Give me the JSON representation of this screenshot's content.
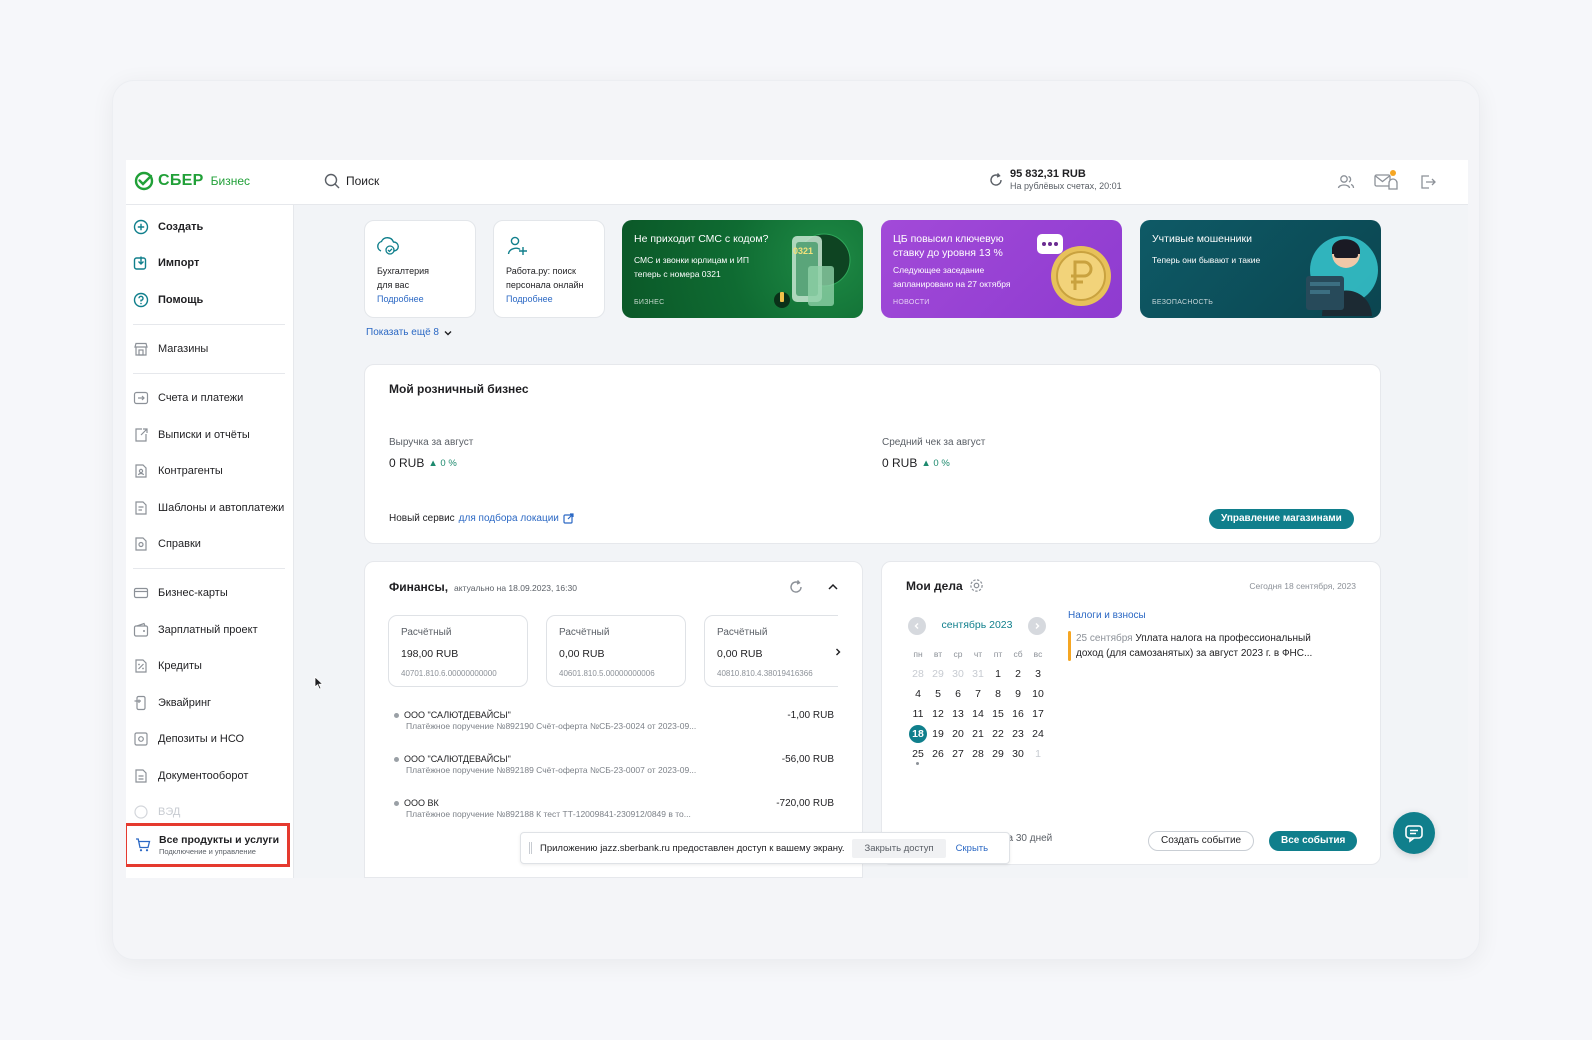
{
  "header": {
    "logo_text": "СБЕР",
    "logo_sub": "Бизнес",
    "search_label": "Поиск",
    "balance_amount": "95 832,31 RUB",
    "balance_sub": "На рублёвых счетах, 20:01"
  },
  "sidebar": {
    "create": "Создать",
    "import": "Импорт",
    "help": "Помощь",
    "shops": "Магазины",
    "accounts": "Счета и платежи",
    "statements": "Выписки и отчёты",
    "counterparties": "Контрагенты",
    "templates": "Шаблоны и автоплатежи",
    "certificates": "Справки",
    "cards": "Бизнес-карты",
    "salary": "Зарплатный проект",
    "credits": "Кредиты",
    "acquiring": "Эквайринг",
    "deposits": "Депозиты и НСО",
    "docs": "Документооборот",
    "ved": "ВЭД",
    "all_products": "Все продукты и услуги",
    "all_products_sub": "Подключение и управление"
  },
  "promos": {
    "p1_line1": "Бухгалтерия",
    "p1_line2": "для вас",
    "p1_link": "Подробнее",
    "p2_line1": "Работа.ру: поиск",
    "p2_line2": "персонала онлайн",
    "p2_link": "Подробнее",
    "p3_title": "Не приходит СМС с кодом?",
    "p3_body1": "СМС и звонки юрлицам и ИП",
    "p3_body2": "теперь с номера 0321",
    "p3_tag": "БИЗНЕС",
    "p3_badge": "0321",
    "p4_title1": "ЦБ повысил ключевую",
    "p4_title2": "ставку до уровня 13 %",
    "p4_body1": "Следующее заседание",
    "p4_body2": "запланировано на 27 октября",
    "p4_tag": "НОВОСТИ",
    "p5_title": "Учтивые мошенники",
    "p5_body": "Теперь они бывают и такие",
    "p5_tag": "БЕЗОПАСНОСТЬ",
    "show_more": "Показать ещё 8"
  },
  "retail": {
    "title": "Мой розничный бизнес",
    "revenue_label": "Выручка за август",
    "revenue_value": "0 RUB",
    "revenue_delta": "0 %",
    "avg_label": "Средний чек за август",
    "avg_value": "0 RUB",
    "avg_delta": "0 %",
    "service_text": "Новый сервис",
    "service_link": "для подбора локации",
    "manage_button": "Управление магазинами"
  },
  "finance": {
    "title": "Финансы,",
    "updated": "актуально на 18.09.2023, 16:30",
    "accounts": [
      {
        "type": "Расчётный",
        "amount": "198,00 RUB",
        "number": "40701.810.6.00000000000"
      },
      {
        "type": "Расчётный",
        "amount": "0,00 RUB",
        "number": "40601.810.5.00000000006"
      },
      {
        "type": "Расчётный",
        "amount": "0,00 RUB",
        "number": "40810.810.4.38019416366"
      }
    ],
    "transactions": [
      {
        "name": "ООО \"САЛЮТДЕВАЙСЫ\"",
        "desc": "Платёжное поручение №892190 Счёт-оферта №СБ-23-0024 от 2023-09...",
        "amount": "-1,00 RUB"
      },
      {
        "name": "ООО \"САЛЮТДЕВАЙСЫ\"",
        "desc": "Платёжное поручение №892189 Счёт-оферта №СБ-23-0007 от 2023-09...",
        "amount": "-56,00 RUB"
      },
      {
        "name": "ООО ВК",
        "desc": "Платёжное поручение №892188 К тест ТТ-12009841-230912/0849 в то...",
        "amount": "-720,00 RUB"
      }
    ]
  },
  "tasks": {
    "title": "Мои дела",
    "today": "Сегодня 18 сентября, 2023",
    "month": "сентябрь 2023",
    "weekdays": [
      "пн",
      "вт",
      "ср",
      "чт",
      "пт",
      "сб",
      "вс"
    ],
    "weeks": [
      [
        "28",
        "29",
        "30",
        "31",
        "1",
        "2",
        "3"
      ],
      [
        "4",
        "5",
        "6",
        "7",
        "8",
        "9",
        "10"
      ],
      [
        "11",
        "12",
        "13",
        "14",
        "15",
        "16",
        "17"
      ],
      [
        "18",
        "19",
        "20",
        "21",
        "22",
        "23",
        "24"
      ],
      [
        "25",
        "26",
        "27",
        "28",
        "29",
        "30",
        "1"
      ]
    ],
    "category": "Налоги и взносы",
    "event_date": "25 сентября",
    "event_text1": "Уплата налога на профессиональный",
    "event_text2": "доход (для самозанятых) за август 2023 г. в ФНС...",
    "period_text": "на 30 дней",
    "create_button": "Создать событие",
    "all_button": "Все события"
  },
  "share_bar": {
    "text": "Приложению jazz.sberbank.ru предоставлен доступ к вашему экрану.",
    "stop": "Закрыть доступ",
    "hide": "Скрыть"
  },
  "colors": {
    "brand": "#21a038",
    "accent": "#107f8c",
    "link": "#2b68c4",
    "highlight": "#e53a2f"
  }
}
